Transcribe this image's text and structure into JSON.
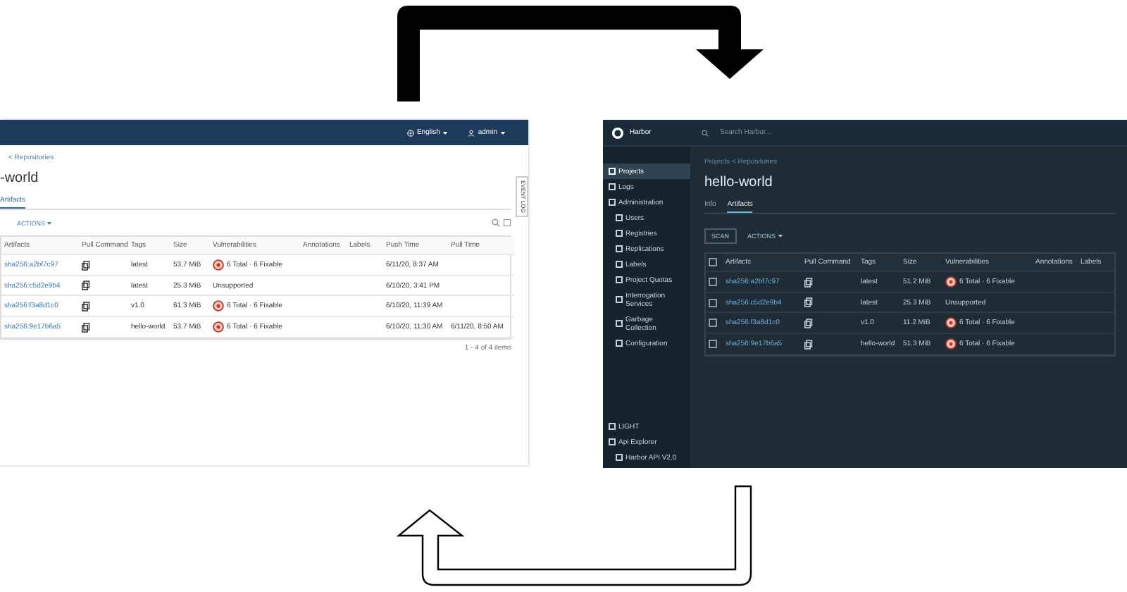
{
  "light_window": {
    "header": {
      "language": "English",
      "user": "admin"
    },
    "breadcrumb": "< Repositories",
    "title": "-world",
    "tabs": [
      {
        "label": "Artifacts",
        "selected": true
      }
    ],
    "actions": "ACTIONS",
    "event_log": "EVENT LOG",
    "columns": [
      "Artifacts",
      "Pull Command",
      "Tags",
      "Size",
      "Vulnerabilities",
      "Annotations",
      "Labels",
      "Push Time",
      "Pull Time"
    ],
    "rows": [
      {
        "artifact": "sha256:a2bf7c97",
        "tags": "latest",
        "size": "53.7 MiB",
        "kind": "scanned",
        "vulnerabilities": "6 Total · 6 Fixable",
        "push_time": "6/11/20, 8:37 AM"
      },
      {
        "artifact": "sha256:c5d2e9b4",
        "tags": "latest",
        "size": "25.3 MiB",
        "kind": "unsupported",
        "vulnerabilities": "Unsupported",
        "push_time": "6/10/20, 3:41 PM"
      },
      {
        "artifact": "sha256:f3a8d1c0",
        "tags": "v1.0",
        "size": "61.3 MiB",
        "kind": "scanned",
        "vulnerabilities": "6 Total · 6 Fixable",
        "push_time": "6/10/20, 11:39 AM"
      },
      {
        "artifact": "sha256:9e17b6a5",
        "tags": "hello-world",
        "size": "53.7 MiB",
        "kind": "scanned",
        "vulnerabilities": "6 Total · 6 Fixable",
        "push_time": "6/10/20, 11:30 AM",
        "pull_time": "6/11/20, 8:50 AM"
      }
    ],
    "footer": "1 - 4 of 4 items"
  },
  "dark_window": {
    "brand": "Harbor",
    "search": {
      "placeholder": "Search Harbor..."
    },
    "sidebar": [
      {
        "label": "Projects",
        "selected": true
      },
      {
        "label": "Logs",
        "selected": false
      },
      {
        "label": "Administration",
        "selected": false,
        "children": [
          {
            "label": "Users",
            "selected": false
          },
          {
            "label": "Registries",
            "selected": false
          },
          {
            "label": "Replications",
            "selected": false
          },
          {
            "label": "Labels",
            "selected": false
          },
          {
            "label": "Project Quotas",
            "selected": false
          },
          {
            "label": "Interrogation Services",
            "selected": false
          },
          {
            "label": "Garbage Collection",
            "selected": false
          },
          {
            "label": "Configuration",
            "selected": false
          }
        ]
      }
    ],
    "bottom_items": [
      "LIGHT",
      "Api Explorer",
      "Harbor API V2.0"
    ],
    "breadcrumb": "Projects < Repositories",
    "title": "hello-world",
    "tabs": [
      {
        "label": "Info",
        "selected": false
      },
      {
        "label": "Artifacts",
        "selected": true
      }
    ],
    "scan": "SCAN",
    "actions": "ACTIONS",
    "select_all": {
      "checked": false
    },
    "columns": [
      "Artifacts",
      "Pull Command",
      "Tags",
      "Size",
      "Vulnerabilities",
      "Annotations",
      "Labels"
    ],
    "rows": [
      {
        "checked": false,
        "artifact": "sha256:a2bf7c97",
        "tags": "latest",
        "size": "51.2 MiB",
        "kind": "scanned",
        "vulnerabilities": "6 Total · 6 Fixable"
      },
      {
        "checked": false,
        "artifact": "sha256:c5d2e9b4",
        "tags": "latest",
        "size": "25.3 MiB",
        "kind": "unsupported",
        "vulnerabilities": "Unsupported"
      },
      {
        "checked": false,
        "artifact": "sha256:f3a8d1c0",
        "tags": "v1.0",
        "size": "11.2 MiB",
        "kind": "scanned",
        "vulnerabilities": "6 Total · 6 Fixable"
      },
      {
        "checked": false,
        "artifact": "sha256:9e17b6a5",
        "tags": "hello-world",
        "size": "51.3 MiB",
        "kind": "scanned",
        "vulnerabilities": "6 Total · 6 Fixable"
      }
    ]
  }
}
